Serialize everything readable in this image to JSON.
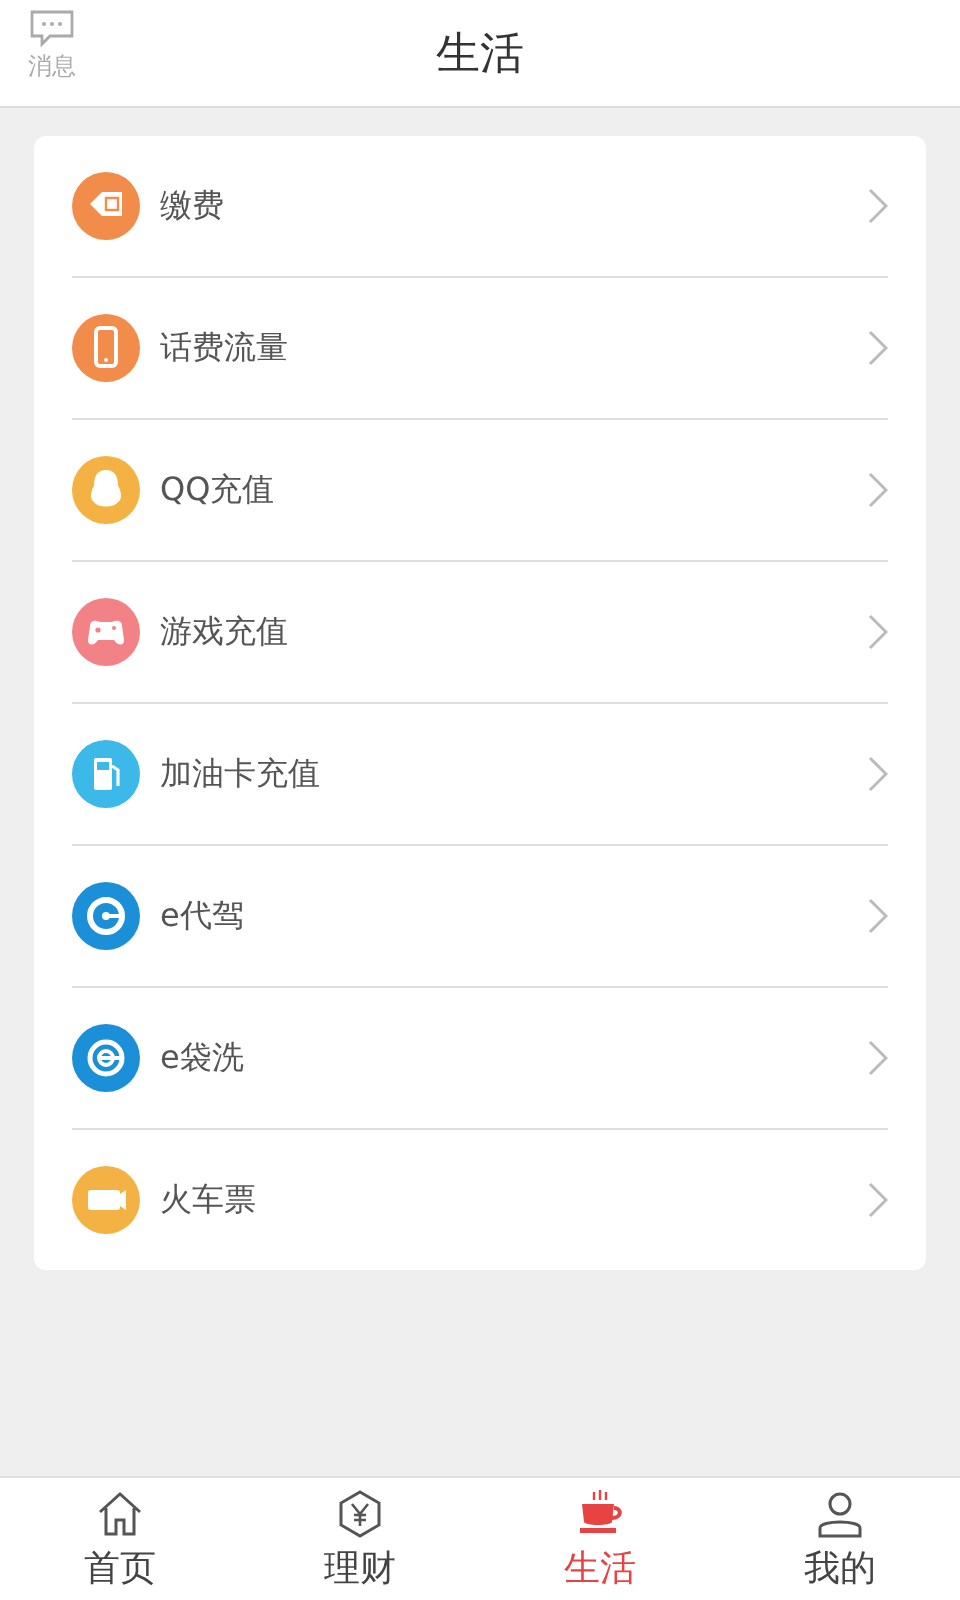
{
  "header": {
    "message_label": "消息",
    "title": "生活"
  },
  "services": [
    {
      "kind": "card",
      "label": "缴费",
      "color": "#f28c4a"
    },
    {
      "kind": "phone",
      "label": "话费流量",
      "color": "#f28c4a"
    },
    {
      "kind": "penguin",
      "label": "QQ充值",
      "color": "#f5b244"
    },
    {
      "kind": "gamepad",
      "label": "游戏充值",
      "color": "#f38287"
    },
    {
      "kind": "fuel",
      "label": "加油卡充值",
      "color": "#3db9e9"
    },
    {
      "kind": "e-drive",
      "label": "e代驾",
      "color": "#1c8fd9"
    },
    {
      "kind": "e-wash",
      "label": "e袋洗",
      "color": "#1c8fd9"
    },
    {
      "kind": "ticket",
      "label": "火车票",
      "color": "#f5b244"
    }
  ],
  "tabs": [
    {
      "kind": "home",
      "label": "首页",
      "selected": false
    },
    {
      "kind": "finance",
      "label": "理财",
      "selected": false
    },
    {
      "kind": "life",
      "label": "生活",
      "selected": true
    },
    {
      "kind": "me",
      "label": "我的",
      "selected": false
    }
  ]
}
